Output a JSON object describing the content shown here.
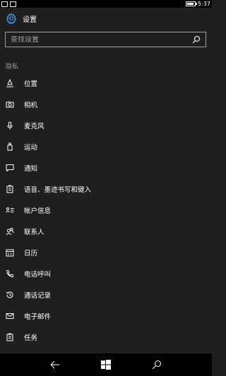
{
  "status_bar": {
    "time": "5:37",
    "battery_level": 0.9
  },
  "header": {
    "icon": "gear-icon",
    "title": "设置"
  },
  "search": {
    "placeholder": "查找设置",
    "icon": "search-icon"
  },
  "section": {
    "label": "隐私"
  },
  "items": [
    {
      "label": "位置",
      "icon": "location-icon"
    },
    {
      "label": "相机",
      "icon": "camera-icon"
    },
    {
      "label": "麦克风",
      "icon": "microphone-icon"
    },
    {
      "label": "运动",
      "icon": "motion-icon"
    },
    {
      "label": "通知",
      "icon": "notification-icon"
    },
    {
      "label": "语音、墨迹书写和键入",
      "icon": "speech-inking-icon"
    },
    {
      "label": "帐户信息",
      "icon": "account-info-icon"
    },
    {
      "label": "联系人",
      "icon": "contacts-icon"
    },
    {
      "label": "日历",
      "icon": "calendar-icon"
    },
    {
      "label": "电话呼叫",
      "icon": "phone-icon"
    },
    {
      "label": "通话记录",
      "icon": "call-history-icon"
    },
    {
      "label": "电子邮件",
      "icon": "mail-icon"
    },
    {
      "label": "任务",
      "icon": "tasks-icon"
    }
  ],
  "colors": {
    "accent": "#4da3ff",
    "background": "#1f1f1f",
    "bar": "#000000"
  }
}
